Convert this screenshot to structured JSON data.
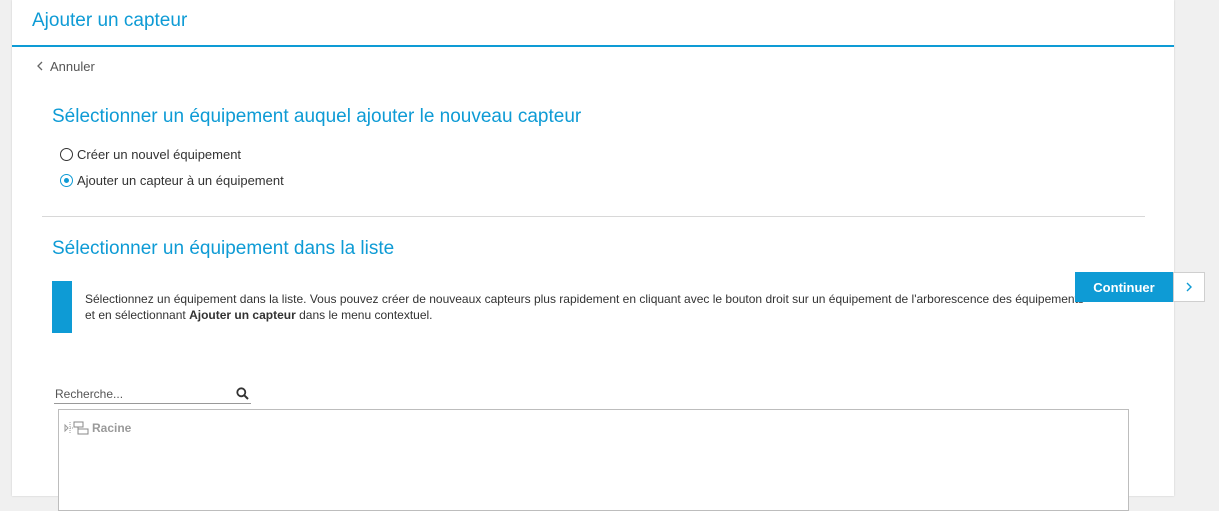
{
  "header": {
    "title": "Ajouter un capteur"
  },
  "back": {
    "label": "Annuler"
  },
  "section1": {
    "title": "Sélectionner un équipement auquel ajouter le nouveau capteur",
    "options": [
      {
        "label": "Créer un nouvel équipement",
        "checked": false
      },
      {
        "label": "Ajouter un capteur à un équipement",
        "checked": true
      }
    ]
  },
  "section2": {
    "title": "Sélectionner un équipement dans la liste",
    "info_text_1": "Sélectionnez un équipement dans la liste. Vous pouvez créer de nouveaux capteurs plus rapidement en cliquant avec le bouton droit sur un équipement de l'arborescence des équipements et en sélectionnant ",
    "info_bold": "Ajouter un capteur",
    "info_text_2": " dans le menu contextuel."
  },
  "search": {
    "placeholder": "Recherche...",
    "value": ""
  },
  "tree": {
    "root_label": "Racine"
  },
  "actions": {
    "continue_label": "Continuer"
  },
  "colors": {
    "accent": "#0e9bd5"
  },
  "icons": {
    "back": "chevron-left-icon",
    "search": "search-icon",
    "tree": "device-tree-icon",
    "next": "chevron-right-icon"
  }
}
